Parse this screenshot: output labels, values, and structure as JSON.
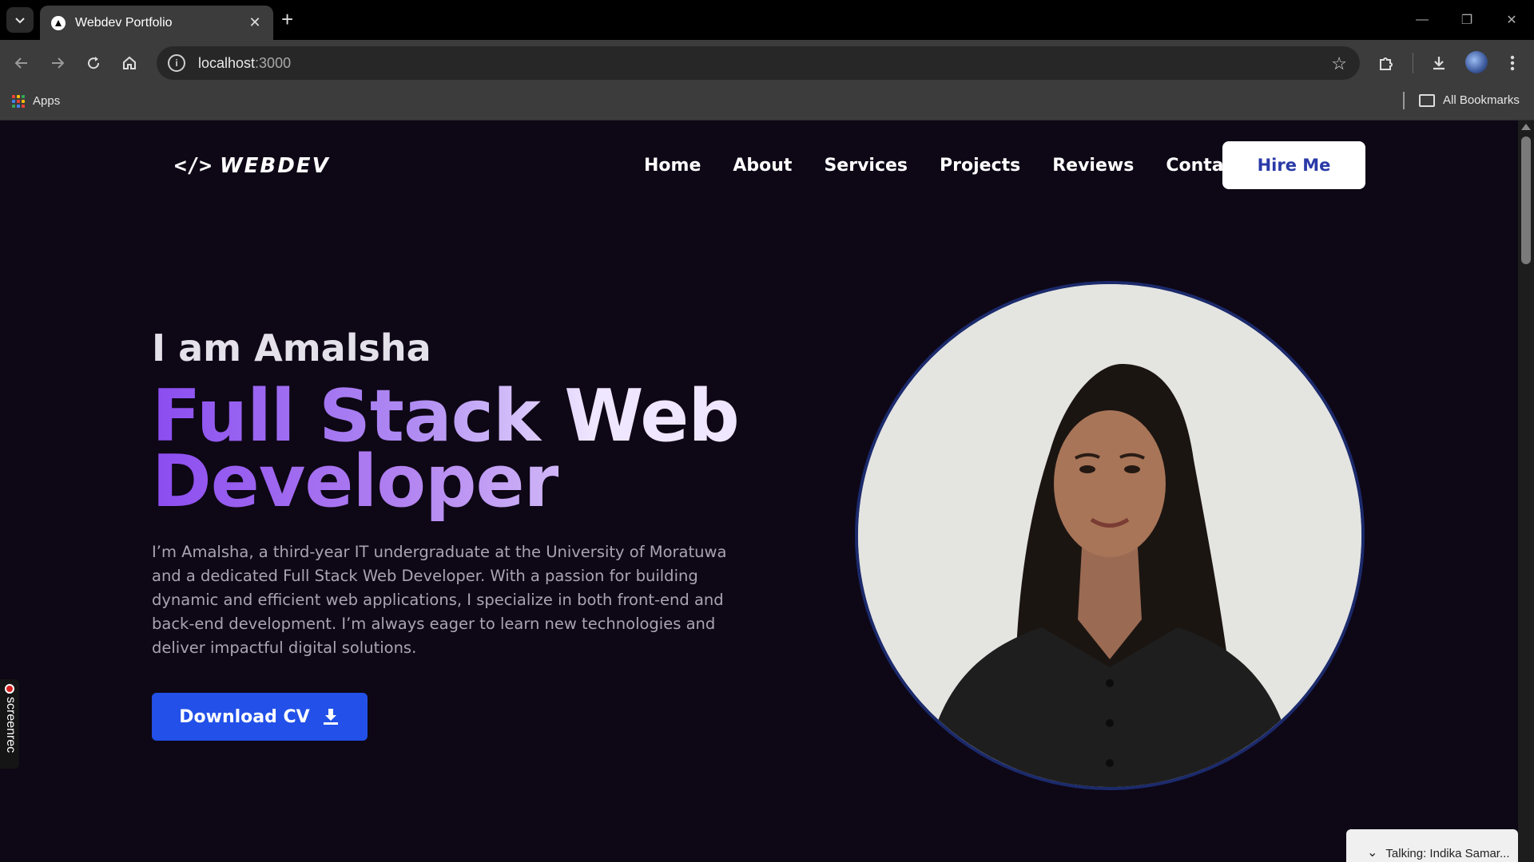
{
  "browser": {
    "tab_title": "Webdev Portfolio",
    "url_host": "localhost",
    "url_port": ":3000",
    "bookmarks_apps": "Apps",
    "bookmarks_all": "All Bookmarks"
  },
  "site": {
    "logo_code": "</>",
    "logo_text": "WEBDEV",
    "nav": [
      "Home",
      "About",
      "Services",
      "Projects",
      "Reviews",
      "Contact"
    ],
    "hire_label": "Hire Me"
  },
  "hero": {
    "intro": "I am Amalsha",
    "headline_line1": "Full Stack Web",
    "headline_line2": "Developer",
    "bio": "I’m Amalsha, a third-year IT undergraduate at the University of Moratuwa and a dedicated Full Stack Web Developer. With a passion for building dynamic and efficient web applications, I specialize in both front-end and back-end development. I’m always eager to learn new technologies and deliver impactful digital solutions.",
    "cv_label": "Download CV"
  },
  "overlays": {
    "recorder": "screenrec",
    "talking": "Talking: Indika Samar..."
  },
  "colors": {
    "page_bg": "#0e0716",
    "accent": "#8b4cf0",
    "cv_button": "#2250e8",
    "hire_text": "#2a3aa8"
  }
}
